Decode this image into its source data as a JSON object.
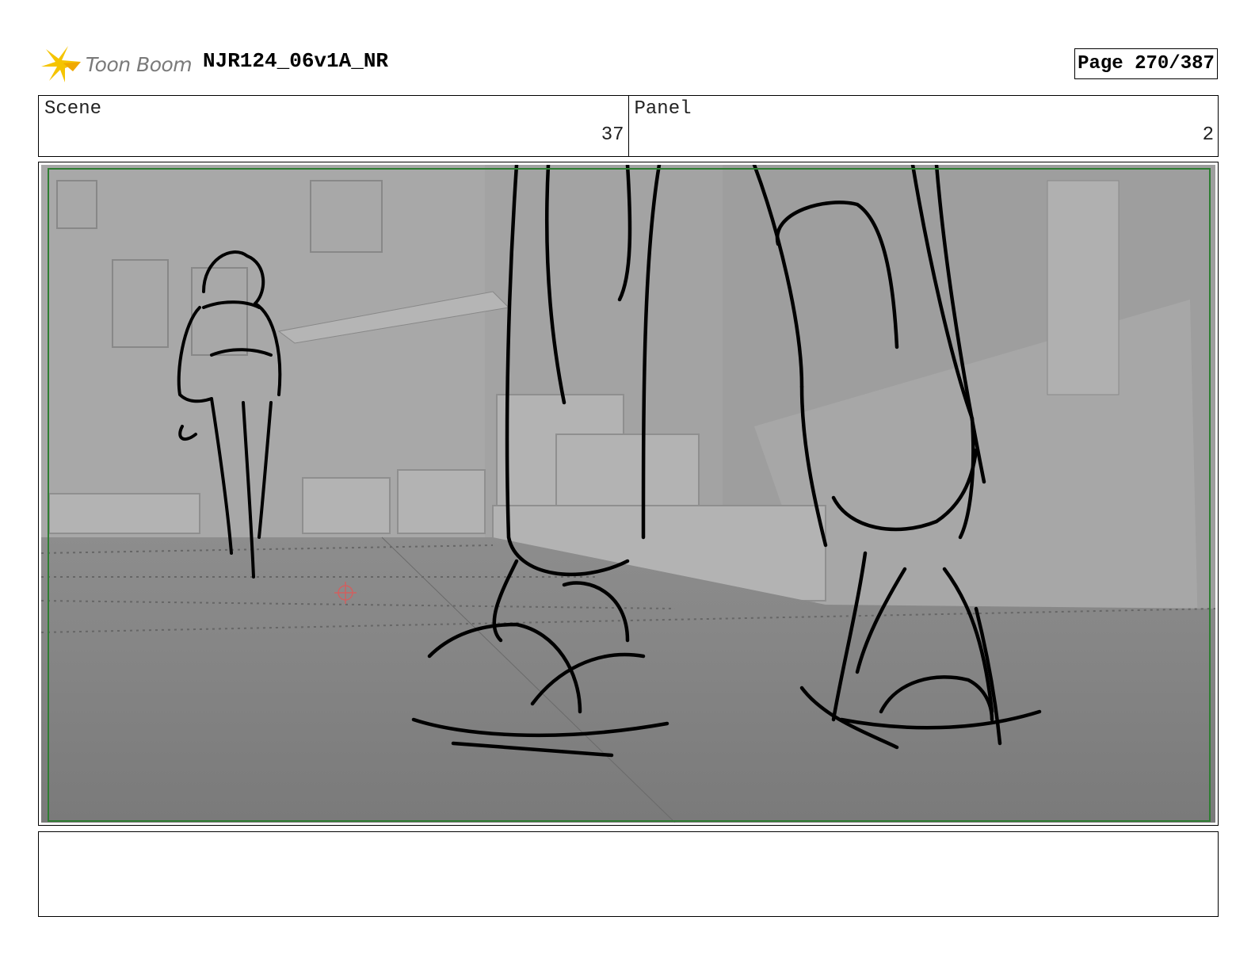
{
  "header": {
    "logo_text": "Toon Boom",
    "project_title": "NJR124_06v1A_NR",
    "page_label": "Page 270/387"
  },
  "info": {
    "scene_label": "Scene",
    "scene_value": "37",
    "panel_label": "Panel",
    "panel_value": "2"
  },
  "frame": {
    "content": "storyboard-sketch",
    "safe_area_color": "#2e7d32"
  },
  "notes": {
    "text": ""
  },
  "colors": {
    "logo_accent": "#f5c400",
    "logo_text": "#7a7a7a",
    "background_gray": "#8e8e8e"
  }
}
